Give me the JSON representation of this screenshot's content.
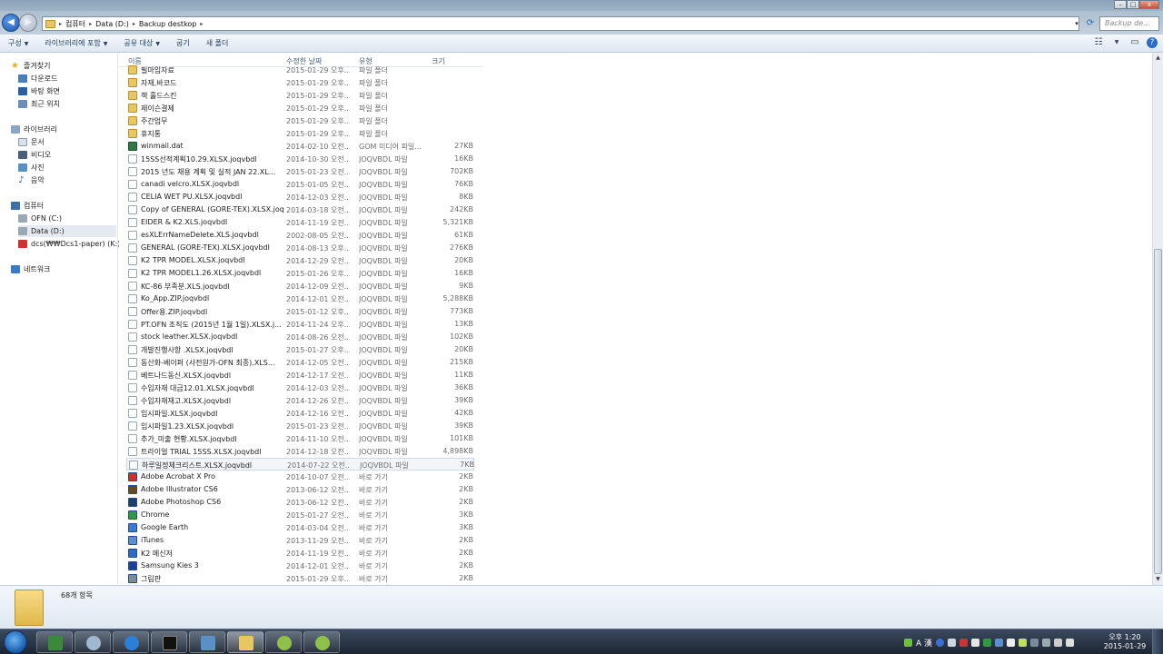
{
  "window": {
    "minimize": "–",
    "maximize": "□",
    "close": "x"
  },
  "address": {
    "back_icon": "◀",
    "forward_icon": "▶",
    "crumbs": [
      "컴퓨터",
      "Data (D:)",
      "Backup destkop"
    ],
    "search_placeholder": "Backup de..."
  },
  "toolbar": {
    "organize": "구성",
    "include_in_library": "라이브러리에 포함",
    "share_with": "공유 대상",
    "burn": "굽기",
    "new_folder": "새 폴더"
  },
  "nav": {
    "favorites": "즐겨찾기",
    "downloads": "다운로드",
    "desktop": "바탕 화면",
    "recent": "최근 위치",
    "libraries": "라이브러리",
    "documents": "문서",
    "videos": "비디오",
    "pictures": "사진",
    "music": "음악",
    "computer": "컴퓨터",
    "drive_c": "OFN (C:)",
    "drive_d": "Data (D:)",
    "drive_k": "dcs(₩₩Dcs1-paper) (K:)",
    "network": "네트워크"
  },
  "columns": {
    "name": "이름",
    "date": "수정한 날짜",
    "type": "유형",
    "size": "크기"
  },
  "files": [
    {
      "icon": "folder",
      "name": "필마임자료",
      "date": "2015-01-29 오후...",
      "type": "파일 폴더",
      "size": ""
    },
    {
      "icon": "folder",
      "name": "자재,바코드",
      "date": "2015-01-29 오후...",
      "type": "파일 폴더",
      "size": ""
    },
    {
      "icon": "folder",
      "name": "책 홀드스킨",
      "date": "2015-01-29 오후...",
      "type": "파일 폴더",
      "size": ""
    },
    {
      "icon": "folder",
      "name": "제이슨결제",
      "date": "2015-01-29 오후...",
      "type": "파일 폴더",
      "size": ""
    },
    {
      "icon": "folder",
      "name": "주간업무",
      "date": "2015-01-29 오후...",
      "type": "파일 폴더",
      "size": ""
    },
    {
      "icon": "folder",
      "name": "휴지통",
      "date": "2015-01-29 오후...",
      "type": "파일 폴더",
      "size": ""
    },
    {
      "icon": "gom",
      "name": "winmail.dat",
      "date": "2014-02-10 오전...",
      "type": "GOM 미디어 파일...",
      "size": "27KB"
    },
    {
      "icon": "file",
      "name": "15SS선적계획10.29.XLSX.joqvbdl",
      "date": "2014-10-30 오전...",
      "type": "JOQVBDL 파일",
      "size": "16KB"
    },
    {
      "icon": "file",
      "name": "2015 년도 채용 계획 및 실적 JAN 22.XL...",
      "date": "2015-01-23 오전...",
      "type": "JOQVBDL 파일",
      "size": "702KB"
    },
    {
      "icon": "file",
      "name": "canadi velcro.XLSX.joqvbdl",
      "date": "2015-01-05 오전...",
      "type": "JOQVBDL 파일",
      "size": "76KB"
    },
    {
      "icon": "file",
      "name": "CELIA WET PU.XLSX.joqvbdl",
      "date": "2014-12-03 오전...",
      "type": "JOQVBDL 파일",
      "size": "8KB"
    },
    {
      "icon": "file",
      "name": "Copy of GENERAL (GORE-TEX).XLSX.joq...",
      "date": "2014-03-18 오전...",
      "type": "JOQVBDL 파일",
      "size": "242KB"
    },
    {
      "icon": "file",
      "name": "EIDER & K2.XLS.joqvbdl",
      "date": "2014-11-19 오전...",
      "type": "JOQVBDL 파일",
      "size": "5,321KB"
    },
    {
      "icon": "file",
      "name": "esXLErrNameDelete.XLS.joqvbdl",
      "date": "2002-08-05 오전...",
      "type": "JOQVBDL 파일",
      "size": "61KB"
    },
    {
      "icon": "file",
      "name": "GENERAL (GORE-TEX).XLSX.joqvbdl",
      "date": "2014-08-13 오후...",
      "type": "JOQVBDL 파일",
      "size": "276KB"
    },
    {
      "icon": "file",
      "name": "K2 TPR MODEL.XLSX.joqvbdl",
      "date": "2014-12-29 오전...",
      "type": "JOQVBDL 파일",
      "size": "20KB"
    },
    {
      "icon": "file",
      "name": "K2 TPR MODEL1.26.XLSX.joqvbdl",
      "date": "2015-01-26 오후...",
      "type": "JOQVBDL 파일",
      "size": "16KB"
    },
    {
      "icon": "file",
      "name": "KC-86 부족분.XLS.joqvbdl",
      "date": "2014-12-09 오전...",
      "type": "JOQVBDL 파일",
      "size": "9KB"
    },
    {
      "icon": "file",
      "name": "Ko_App.ZIP.joqvbdl",
      "date": "2014-12-01 오전...",
      "type": "JOQVBDL 파일",
      "size": "5,288KB"
    },
    {
      "icon": "file",
      "name": "Offer용.ZIP.joqvbdl",
      "date": "2015-01-12 오후...",
      "type": "JOQVBDL 파일",
      "size": "773KB"
    },
    {
      "icon": "file",
      "name": "PT.OFN 조직도 (2015년 1월 1일).XLSX.j...",
      "date": "2014-11-24 오후...",
      "type": "JOQVBDL 파일",
      "size": "13KB"
    },
    {
      "icon": "file",
      "name": "stock leather.XLSX.joqvbdl",
      "date": "2014-08-26 오전...",
      "type": "JOQVBDL 파일",
      "size": "102KB"
    },
    {
      "icon": "file",
      "name": "개발진행사항 .XLSX.joqvbdl",
      "date": "2015-01-27 오후...",
      "type": "JOQVBDL 파일",
      "size": "20KB"
    },
    {
      "icon": "file",
      "name": "동산화-베이퍼 (사전원가-OFN 최종).XLS...",
      "date": "2014-12-05 오전...",
      "type": "JOQVBDL 파일",
      "size": "215KB"
    },
    {
      "icon": "file",
      "name": "베트나드동신.XLSX.joqvbdl",
      "date": "2014-12-17 오전...",
      "type": "JOQVBDL 파일",
      "size": "11KB"
    },
    {
      "icon": "file",
      "name": "수입자재 대금12.01.XLSX.joqvbdl",
      "date": "2014-12-03 오전...",
      "type": "JOQVBDL 파일",
      "size": "36KB"
    },
    {
      "icon": "file",
      "name": "수입자재재고.XLSX.joqvbdl",
      "date": "2014-12-26 오전...",
      "type": "JOQVBDL 파일",
      "size": "39KB"
    },
    {
      "icon": "file",
      "name": "임시파일.XLSX.joqvbdl",
      "date": "2014-12-16 오전...",
      "type": "JOQVBDL 파일",
      "size": "42KB"
    },
    {
      "icon": "file",
      "name": "임시파일1.23.XLSX.joqvbdl",
      "date": "2015-01-23 오전...",
      "type": "JOQVBDL 파일",
      "size": "39KB"
    },
    {
      "icon": "file",
      "name": "추가_미출 현황.XLSX.joqvbdl",
      "date": "2014-11-10 오전...",
      "type": "JOQVBDL 파일",
      "size": "101KB"
    },
    {
      "icon": "file",
      "name": "트라이얼 TRIAL 15SS.XLSX.joqvbdl",
      "date": "2014-12-18 오전...",
      "type": "JOQVBDL 파일",
      "size": "4,898KB"
    },
    {
      "icon": "file",
      "name": "하루일정체크리스트.XLSX.joqvbdl",
      "date": "2014-07-22 오전...",
      "type": "JOQVBDL 파일",
      "size": "7KB",
      "selected": true
    },
    {
      "icon": "shortcut",
      "color": "#c2362b",
      "name": "Adobe Acrobat X Pro",
      "date": "2014-10-07 오전...",
      "type": "바로 가기",
      "size": "2KB"
    },
    {
      "icon": "shortcut",
      "color": "#6b4a1e",
      "name": "Adobe Illustrator CS6",
      "date": "2013-06-12 오전...",
      "type": "바로 가기",
      "size": "2KB"
    },
    {
      "icon": "shortcut",
      "color": "#1d3f6e",
      "name": "Adobe Photoshop CS6",
      "date": "2013-06-12 오전...",
      "type": "바로 가기",
      "size": "2KB"
    },
    {
      "icon": "shortcut",
      "color": "#2f9a3c",
      "name": "Chrome",
      "date": "2015-01-27 오전...",
      "type": "바로 가기",
      "size": "3KB"
    },
    {
      "icon": "shortcut",
      "color": "#3a7bd5",
      "name": "Google Earth",
      "date": "2014-03-04 오전...",
      "type": "바로 가기",
      "size": "3KB"
    },
    {
      "icon": "shortcut",
      "color": "#5b8fd0",
      "name": "iTunes",
      "date": "2013-11-29 오전...",
      "type": "바로 가기",
      "size": "2KB"
    },
    {
      "icon": "shortcut",
      "color": "#2a6cc8",
      "name": "K2 메신저",
      "date": "2014-11-19 오전...",
      "type": "바로 가기",
      "size": "2KB"
    },
    {
      "icon": "shortcut",
      "color": "#1c3f9e",
      "name": "Samsung Kies 3",
      "date": "2014-12-01 오전...",
      "type": "바로 가기",
      "size": "2KB"
    },
    {
      "icon": "shortcut",
      "color": "#7a8b9c",
      "name": "그림판",
      "date": "2015-01-29 오후...",
      "type": "바로 가기",
      "size": "2KB"
    }
  ],
  "details": {
    "item_count": "68개 항목"
  },
  "taskbar": {
    "ime_text": "A 漢",
    "time": "오후 1:20",
    "date": "2015-01-29"
  }
}
